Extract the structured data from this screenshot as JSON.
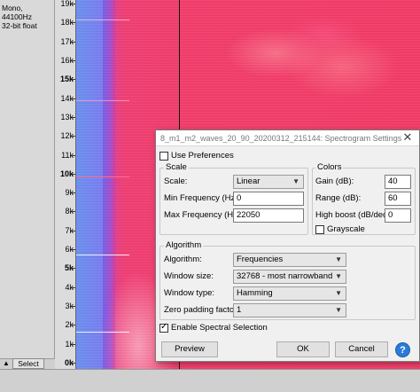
{
  "track": {
    "info_line1": "Mono, 44100Hz",
    "info_line2": "32-bit float",
    "collapse_glyph": "▲",
    "select_label": "Select"
  },
  "ruler": {
    "labels": [
      "19k",
      "18k",
      "17k",
      "16k",
      "15k",
      "14k",
      "13k",
      "12k",
      "11k",
      "10k",
      "9k",
      "8k",
      "7k",
      "6k",
      "5k",
      "4k",
      "3k",
      "2k",
      "1k",
      "0k"
    ],
    "bold_labels": [
      "15k",
      "10k",
      "5k",
      "0k"
    ]
  },
  "dialog": {
    "title": "8_m1_m2_waves_20_90_20200312_215144: Spectrogram Settings",
    "close_glyph": "✕",
    "use_preferences": {
      "label": "Use Preferences",
      "checked": false
    },
    "scale_group": {
      "title": "Scale",
      "scale_label": "Scale:",
      "scale_value": "Linear",
      "min_freq_label": "Min Frequency (Hz):",
      "min_freq_value": "0",
      "max_freq_label": "Max Frequency (Hz):",
      "max_freq_value": "22050"
    },
    "colors_group": {
      "title": "Colors",
      "gain_label": "Gain (dB):",
      "gain_value": "40",
      "range_label": "Range (dB):",
      "range_value": "60",
      "high_boost_label": "High boost (dB/dec):",
      "high_boost_value": "0",
      "grayscale": {
        "label": "Grayscale",
        "checked": false
      }
    },
    "algorithm_group": {
      "title": "Algorithm",
      "algorithm_label": "Algorithm:",
      "algorithm_value": "Frequencies",
      "window_size_label": "Window size:",
      "window_size_value": "32768 - most narrowband",
      "window_type_label": "Window type:",
      "window_type_value": "Hamming",
      "zero_padding_label": "Zero padding factor:",
      "zero_padding_value": "1"
    },
    "spectral_selection": {
      "label": "Enable Spectral Selection",
      "checked": true
    },
    "buttons": {
      "preview": "Preview",
      "ok": "OK",
      "cancel": "Cancel",
      "help": "?"
    }
  },
  "icons": [
    "collapse-arrow-icon",
    "close-icon",
    "dropdown-arrow-icon",
    "checkmark-icon",
    "help-icon"
  ],
  "colors": {
    "spectrogram_hot": "#f33a66",
    "spectrogram_cold": "#6a8ff0",
    "help_blue": "#2b7bd6"
  }
}
